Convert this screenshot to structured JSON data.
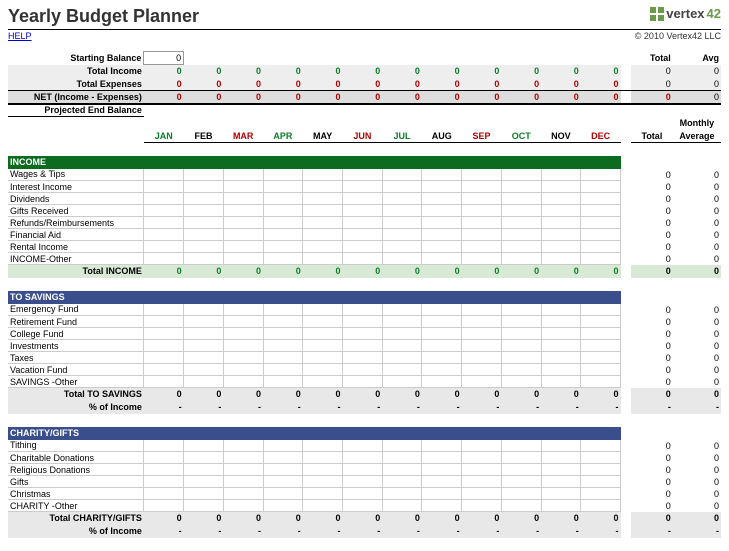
{
  "title": "Yearly Budget Planner",
  "help": "HELP",
  "logo": {
    "pre": "vertex",
    "num": "42"
  },
  "copyright": "© 2010 Vertex42 LLC",
  "labels": {
    "startBal": "Starting Balance",
    "totalIncome": "Total Income",
    "totalExpenses": "Total Expenses",
    "net": "NET (Income - Expenses)",
    "projEnd": "Projected End Balance",
    "total": "Total",
    "avg": "Avg",
    "monthly": "Monthly",
    "average": "Average"
  },
  "startBalVal": "0",
  "months": [
    {
      "n": "JAN",
      "c": "green"
    },
    {
      "n": "FEB",
      "c": ""
    },
    {
      "n": "MAR",
      "c": "red"
    },
    {
      "n": "APR",
      "c": "green"
    },
    {
      "n": "MAY",
      "c": ""
    },
    {
      "n": "JUN",
      "c": "red"
    },
    {
      "n": "JUL",
      "c": "green"
    },
    {
      "n": "AUG",
      "c": ""
    },
    {
      "n": "SEP",
      "c": "red"
    },
    {
      "n": "OCT",
      "c": "green"
    },
    {
      "n": "NOV",
      "c": ""
    },
    {
      "n": "DEC",
      "c": "red"
    }
  ],
  "summary": {
    "totalIncome": {
      "vals": [
        "0",
        "0",
        "0",
        "0",
        "0",
        "0",
        "0",
        "0",
        "0",
        "0",
        "0",
        "0"
      ],
      "t": "0",
      "a": "0"
    },
    "totalExpenses": {
      "vals": [
        "0",
        "0",
        "0",
        "0",
        "0",
        "0",
        "0",
        "0",
        "0",
        "0",
        "0",
        "0"
      ],
      "t": "0",
      "a": "0"
    },
    "net": {
      "vals": [
        "0",
        "0",
        "0",
        "0",
        "0",
        "0",
        "0",
        "0",
        "0",
        "0",
        "0",
        "0"
      ],
      "t": "0",
      "a": "0"
    }
  },
  "sections": [
    {
      "name": "INCOME",
      "color": "green",
      "rows": [
        "Wages & Tips",
        "Interest Income",
        "Dividends",
        "Gifts Received",
        "Refunds/Reimbursements",
        "Financial Aid",
        "Rental Income",
        "INCOME-Other"
      ],
      "totalLabel": "Total INCOME",
      "totalVals": [
        "0",
        "0",
        "0",
        "0",
        "0",
        "0",
        "0",
        "0",
        "0",
        "0",
        "0",
        "0"
      ],
      "totalT": "0",
      "totalA": "0",
      "rowT": "0",
      "rowA": "0",
      "totalStyle": "tot-green"
    },
    {
      "name": "TO SAVINGS",
      "color": "blue",
      "rows": [
        "Emergency Fund",
        "Retirement Fund",
        "College Fund",
        "Investments",
        "Taxes",
        "Vacation Fund",
        "SAVINGS -Other"
      ],
      "totalLabel": "Total TO SAVINGS",
      "totalVals": [
        "0",
        "0",
        "0",
        "0",
        "0",
        "0",
        "0",
        "0",
        "0",
        "0",
        "0",
        "0"
      ],
      "totalT": "0",
      "totalA": "0",
      "rowT": "0",
      "rowA": "0",
      "totalStyle": "tot-gray",
      "pctLabel": "% of Income",
      "pctVals": [
        "-",
        "-",
        "-",
        "-",
        "-",
        "-",
        "-",
        "-",
        "-",
        "-",
        "-",
        "-"
      ],
      "pctT": "-",
      "pctA": "-"
    },
    {
      "name": "CHARITY/GIFTS",
      "color": "blue",
      "rows": [
        "Tithing",
        "Charitable Donations",
        "Religious Donations",
        "Gifts",
        "Christmas",
        "CHARITY -Other"
      ],
      "totalLabel": "Total CHARITY/GIFTS",
      "totalVals": [
        "0",
        "0",
        "0",
        "0",
        "0",
        "0",
        "0",
        "0",
        "0",
        "0",
        "0",
        "0"
      ],
      "totalT": "0",
      "totalA": "0",
      "rowT": "0",
      "rowA": "0",
      "totalStyle": "tot-gray",
      "pctLabel": "% of Income",
      "pctVals": [
        "-",
        "-",
        "-",
        "-",
        "-",
        "-",
        "-",
        "-",
        "-",
        "-",
        "-",
        "-"
      ],
      "pctT": "-",
      "pctA": "-"
    }
  ]
}
